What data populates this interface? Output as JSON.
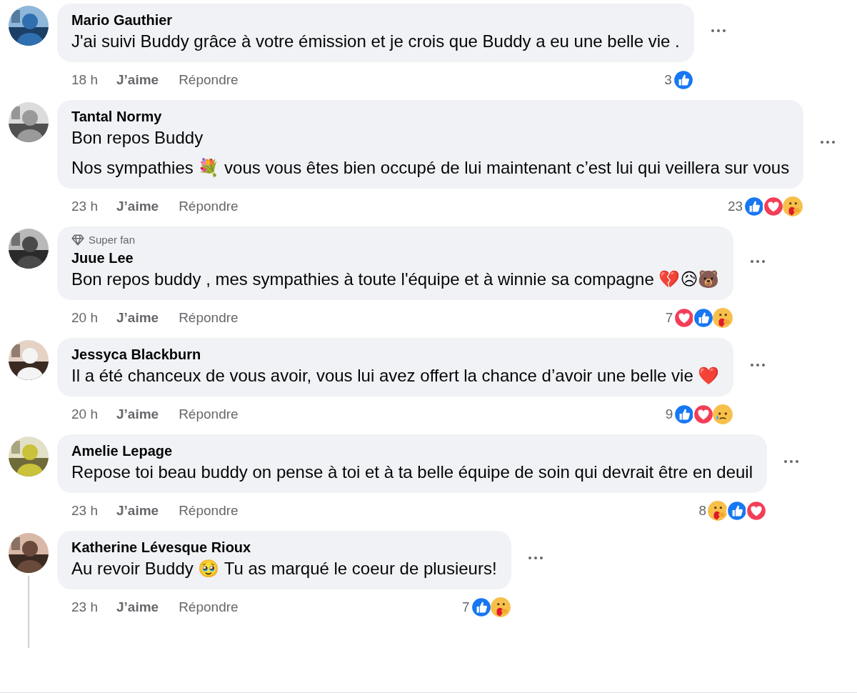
{
  "comments": [
    {
      "author": "Mario Gauthier",
      "paragraphs": [
        "J'ai suivi Buddy grâce à votre émission et je crois que Buddy a eu une belle vie ."
      ],
      "time": "18 h",
      "like": "J’aime",
      "reply": "Répondre",
      "reaction_count": "3",
      "reactions": [
        {
          "kind": "like"
        }
      ],
      "thread_line": false
    },
    {
      "author": "Tantal Normy",
      "paragraphs": [
        "Bon repos Buddy",
        "Nos sympathies 💐 vous vous êtes bien occupé de lui maintenant c’est lui qui veillera sur vous"
      ],
      "time": "23 h",
      "like": "J’aime",
      "reply": "Répondre",
      "reaction_count": "23",
      "reactions": [
        {
          "kind": "like"
        },
        {
          "kind": "love"
        },
        {
          "kind": "care"
        }
      ],
      "thread_line": false
    },
    {
      "badge": "Super fan",
      "author": "Juue Lee",
      "paragraphs": [
        "Bon repos buddy , mes sympathies à toute l'équipe et à winnie sa compagne 💔😥🐻"
      ],
      "time": "20 h",
      "like": "J’aime",
      "reply": "Répondre",
      "reaction_count": "7",
      "reactions": [
        {
          "kind": "love"
        },
        {
          "kind": "like"
        },
        {
          "kind": "care"
        }
      ],
      "thread_line": false
    },
    {
      "author": "Jessyca Blackburn",
      "paragraphs": [
        "Il a été chanceux de vous avoir, vous lui avez offert la chance d’avoir une belle vie ❤️"
      ],
      "time": "20 h",
      "like": "J’aime",
      "reply": "Répondre",
      "reaction_count": "9",
      "reactions": [
        {
          "kind": "like"
        },
        {
          "kind": "love"
        },
        {
          "kind": "sad"
        }
      ],
      "thread_line": false
    },
    {
      "author": "Amelie Lepage",
      "paragraphs": [
        "Repose toi beau buddy on pense à toi et à ta belle équipe de soin qui devrait être en deuil"
      ],
      "time": "23 h",
      "like": "J’aime",
      "reply": "Répondre",
      "reaction_count": "8",
      "reactions": [
        {
          "kind": "care"
        },
        {
          "kind": "like"
        },
        {
          "kind": "love"
        }
      ],
      "thread_line": false
    },
    {
      "author": "Katherine Lévesque Rioux",
      "paragraphs": [
        "Au revoir Buddy 🥹 Tu as marqué le coeur de plusieurs!"
      ],
      "time": "23 h",
      "like": "J’aime",
      "reply": "Répondre",
      "reaction_count": "7",
      "reactions": [
        {
          "kind": "like"
        },
        {
          "kind": "care"
        }
      ],
      "thread_line": true
    }
  ]
}
